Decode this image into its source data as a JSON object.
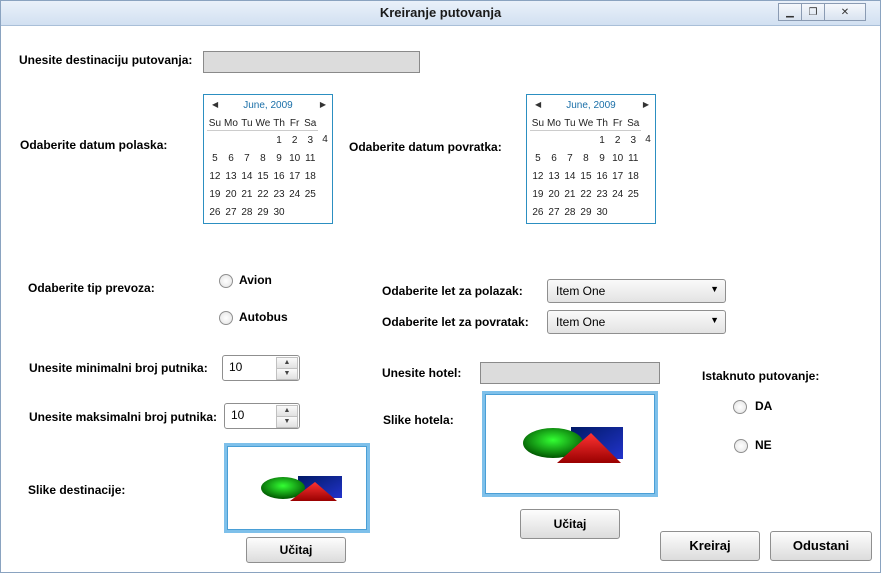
{
  "window": {
    "title": "Kreiranje putovanja",
    "controls": [
      "minimize-icon",
      "restore-icon",
      "close-icon"
    ]
  },
  "destination": {
    "label": "Unesite destinaciju putovanja:",
    "value": ""
  },
  "departure_date": {
    "label": "Odaberite datum polaska:",
    "calendar": {
      "month": "June, 2009",
      "days_of_week": [
        "Su",
        "Mo",
        "Tu",
        "We",
        "Th",
        "Fr",
        "Sa"
      ],
      "weeks": [
        [
          "",
          "",
          "",
          "",
          "1",
          "2",
          "3",
          "4"
        ],
        [
          "5",
          "6",
          "7",
          "8",
          "9",
          "10",
          "11"
        ],
        [
          "12",
          "13",
          "14",
          "15",
          "16",
          "17",
          "18"
        ],
        [
          "19",
          "20",
          "21",
          "22",
          "23",
          "24",
          "25"
        ],
        [
          "26",
          "27",
          "28",
          "29",
          "30",
          "",
          ""
        ]
      ]
    }
  },
  "return_date": {
    "label": "Odaberite datum povratka:",
    "calendar": {
      "month": "June, 2009",
      "days_of_week": [
        "Su",
        "Mo",
        "Tu",
        "We",
        "Th",
        "Fr",
        "Sa"
      ],
      "weeks": [
        [
          "",
          "",
          "",
          "",
          "1",
          "2",
          "3",
          "4"
        ],
        [
          "5",
          "6",
          "7",
          "8",
          "9",
          "10",
          "11"
        ],
        [
          "12",
          "13",
          "14",
          "15",
          "16",
          "17",
          "18"
        ],
        [
          "19",
          "20",
          "21",
          "22",
          "23",
          "24",
          "25"
        ],
        [
          "26",
          "27",
          "28",
          "29",
          "30",
          "",
          ""
        ]
      ]
    }
  },
  "transport": {
    "label": "Odaberite tip prevoza:",
    "options": [
      "Avion",
      "Autobus"
    ]
  },
  "flights": {
    "departure_label": "Odaberite let za polazak:",
    "departure_value": "Item One",
    "return_label": "Odaberite let za povratak:",
    "return_value": "Item One"
  },
  "passengers": {
    "min_label": "Unesite minimalni broj putnika:",
    "min_value": "10",
    "max_label": "Unesite maksimalni broj putnika:",
    "max_value": "10"
  },
  "hotel": {
    "label": "Unesite hotel:",
    "value": "",
    "images_label": "Slike hotela:",
    "upload_label": "Učitaj"
  },
  "featured": {
    "label": "Istaknuto putovanje:",
    "options": [
      "DA",
      "NE"
    ]
  },
  "destination_images": {
    "label": "Slike destinacije:",
    "upload_label": "Učitaj"
  },
  "actions": {
    "create_label": "Kreiraj",
    "cancel_label": "Odustani"
  }
}
